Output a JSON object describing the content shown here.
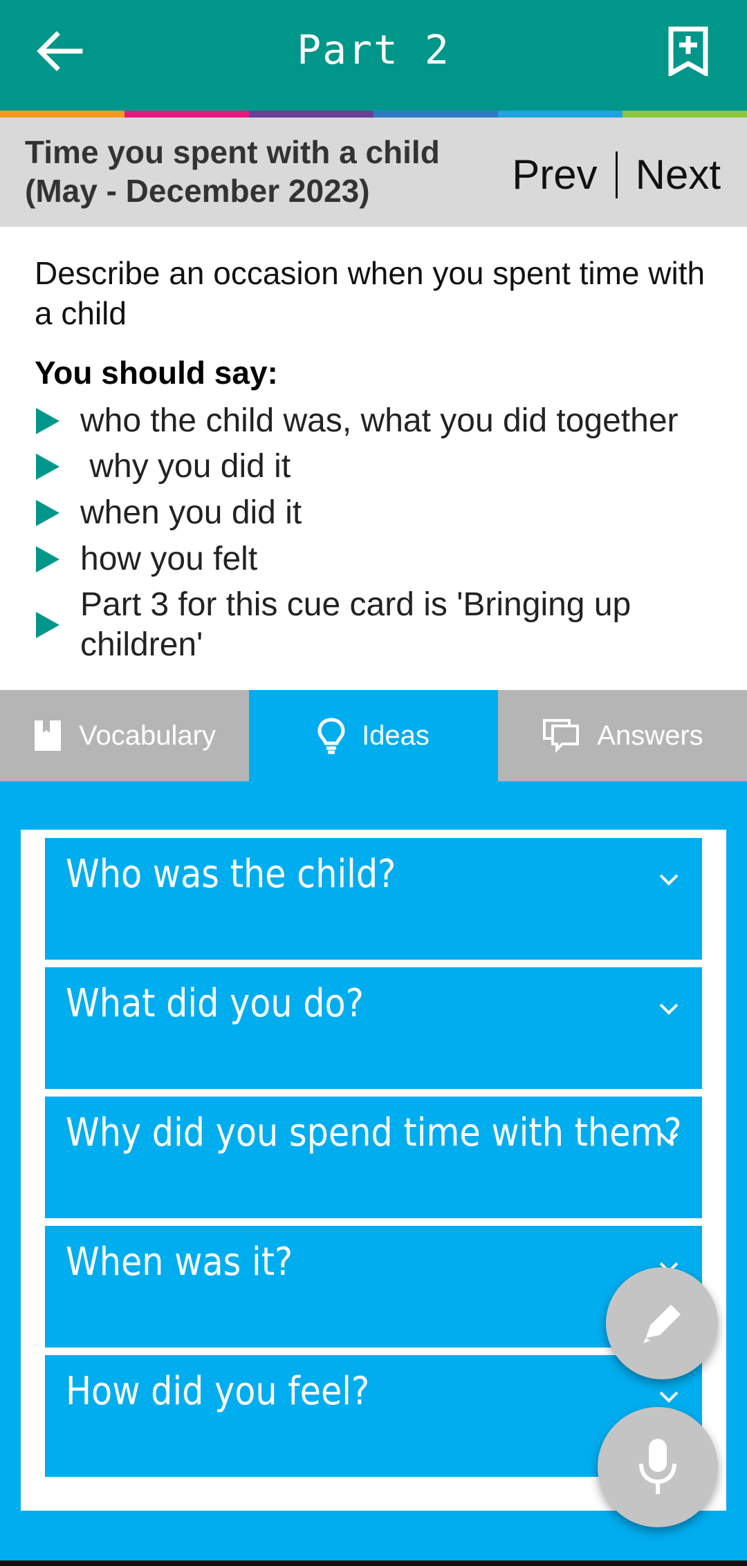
{
  "appbar": {
    "title": "Part 2"
  },
  "stripe_colors": [
    "#F39A1E",
    "#E6197E",
    "#6A3F96",
    "#2E7BC4",
    "#1FA3E1",
    "#8CC63F"
  ],
  "topic": {
    "title_line1": "Time you spent with a child",
    "title_line2": "(May - December 2023)",
    "prev": "Prev",
    "next": "Next"
  },
  "card": {
    "description": "Describe an occasion when you spent time with a child",
    "should_say": "You should say:",
    "bullets": [
      "who the child was, what you did together",
      " why you did it",
      "when you did it",
      "how you felt",
      "Part 3 for this cue card is 'Bringing up children'"
    ]
  },
  "tabs": [
    {
      "label": "Vocabulary",
      "icon": "book-icon",
      "active": false
    },
    {
      "label": "Ideas",
      "icon": "lightbulb-icon",
      "active": true
    },
    {
      "label": "Answers",
      "icon": "chat-icon",
      "active": false
    }
  ],
  "accordion": [
    "Who was the child?",
    "What did you do?",
    "Why did you spend time with them?",
    "When was it?",
    "How did you feel?"
  ],
  "fabs": {
    "edit": "pencil-icon",
    "mic": "microphone-icon"
  },
  "colors": {
    "primary": "#00968A",
    "accent": "#00ADEF",
    "tab_inactive": "#B5B5B5",
    "header_bg": "#D9D9D9"
  }
}
